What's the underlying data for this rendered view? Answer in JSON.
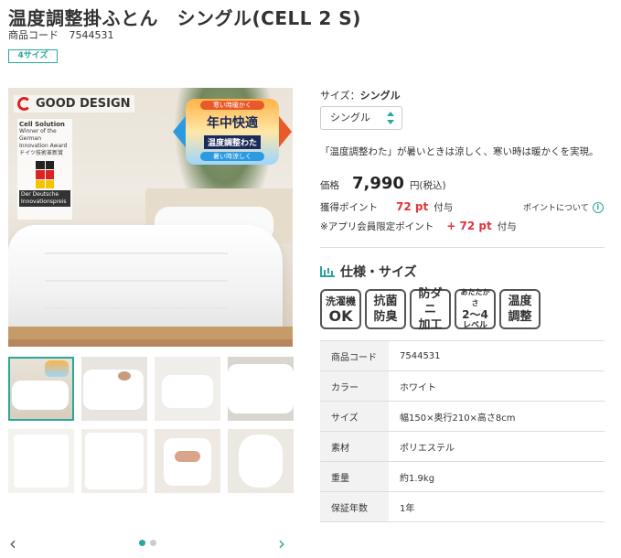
{
  "product": {
    "title": "温度調整掛ふとん　シングル(CELL 2 S)",
    "code_label": "商品コード",
    "code_value": "7544531",
    "size_badge": "4サイズ"
  },
  "main_image": {
    "gd_logo_text": "GOOD DESIGN",
    "cell_solution": "Cell Solution",
    "cell_lines": [
      "Winner of the",
      "German Innovation Award",
      "ドイツ技術革新賞"
    ],
    "innovation_box": "Der Deutsche Innovationspreis",
    "promo_top": "寒い時暖かく",
    "promo_big": "年中快適",
    "promo_mid": "温度調整わた",
    "promo_bottom": "暑い時涼しく"
  },
  "carousel": {
    "prev_icon": "‹",
    "next_icon": "›",
    "dots": 2,
    "active_dot": 0,
    "thumbnail_count": 8,
    "active_thumbnail": 0
  },
  "size_select": {
    "label": "サイズ：",
    "label_value": "シングル",
    "selected": "シングル"
  },
  "description": "「温度調整わた」が暑いときは涼しく、寒い時は暖かくを実現。",
  "price": {
    "label": "価格",
    "value": "7,990",
    "unit": "円(税込)"
  },
  "points": {
    "earn_label": "獲得ポイント",
    "earn_value": "72 pt",
    "earn_suffix": "付与",
    "about_label": "ポイントについて",
    "app_label": "※アプリ会員限定ポイント",
    "app_value": "+ 72 pt",
    "app_suffix": "付与"
  },
  "specs": {
    "heading": "仕様・サイズ",
    "features": [
      {
        "l1": "洗濯機",
        "l2": "OK"
      },
      {
        "l1": "抗菌",
        "l2": "防臭"
      },
      {
        "l1": "防ダニ",
        "l2": "加工"
      },
      {
        "l1": "あたたかさ",
        "l2": "2〜4",
        "l3": "レベル"
      },
      {
        "l1": "温度",
        "l2": "調整"
      }
    ],
    "rows": [
      {
        "k": "商品コード",
        "v": "7544531"
      },
      {
        "k": "カラー",
        "v": "ホワイト"
      },
      {
        "k": "サイズ",
        "v": "幅150×奥行210×高さ8cm"
      },
      {
        "k": "素材",
        "v": "ポリエステル"
      },
      {
        "k": "重量",
        "v": "約1.9kg"
      },
      {
        "k": "保証年数",
        "v": "1年"
      }
    ]
  },
  "colors": {
    "accent": "#2aa79b",
    "point_red": "#e2343a"
  }
}
